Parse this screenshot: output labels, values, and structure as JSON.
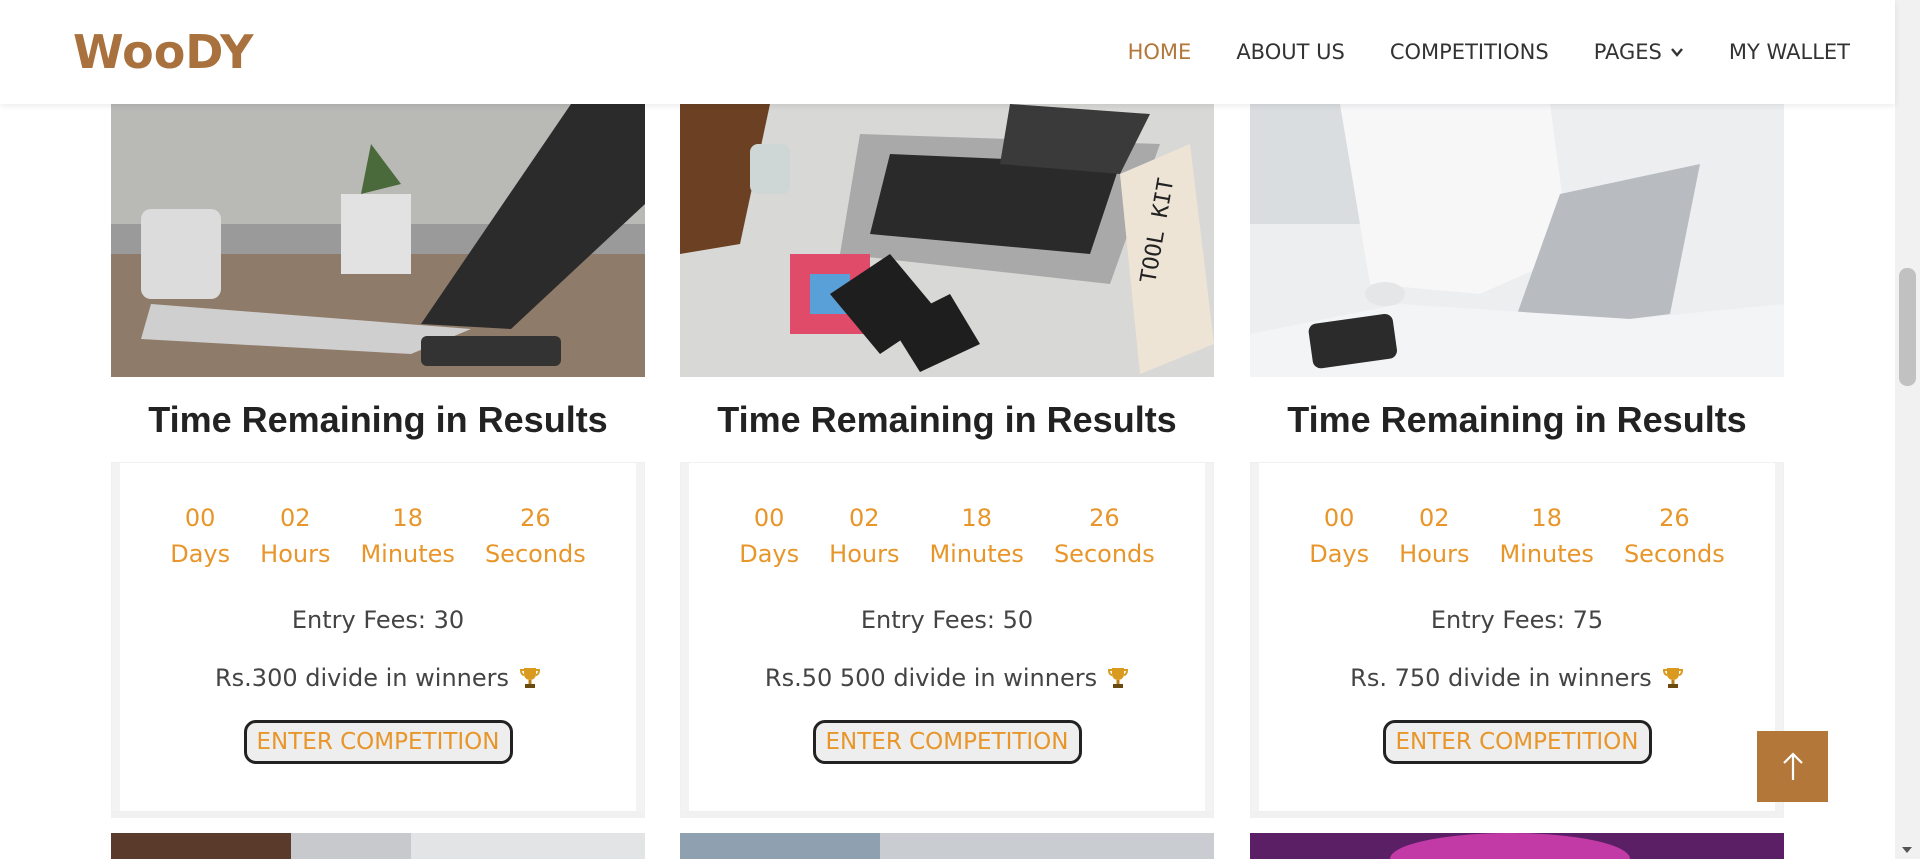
{
  "header": {
    "logo": "WooDY",
    "nav": [
      {
        "label": "HOME",
        "active": true
      },
      {
        "label": "ABOUT US",
        "active": false
      },
      {
        "label": "COMPETITIONS",
        "active": false
      },
      {
        "label": "PAGES",
        "active": false,
        "dropdown": true
      },
      {
        "label": "MY WALLET",
        "active": false
      }
    ]
  },
  "cards": [
    {
      "image_icon": "laptop-desk-photo",
      "title": "Time Remaining in Results",
      "timer": [
        {
          "value": "00",
          "unit": "Days"
        },
        {
          "value": "02",
          "unit": "Hours"
        },
        {
          "value": "18",
          "unit": "Minutes"
        },
        {
          "value": "26",
          "unit": "Seconds"
        }
      ],
      "entry": "Entry Fees: 30",
      "prize": "Rs.300 divide in winners",
      "button": "ENTER COMPETITION"
    },
    {
      "image_icon": "design-laptop-photo",
      "title": "Time Remaining in Results",
      "timer": [
        {
          "value": "00",
          "unit": "Days"
        },
        {
          "value": "02",
          "unit": "Hours"
        },
        {
          "value": "18",
          "unit": "Minutes"
        },
        {
          "value": "26",
          "unit": "Seconds"
        }
      ],
      "entry": "Entry Fees: 50",
      "prize": "Rs.50 500 divide in winners",
      "button": "ENTER COMPETITION"
    },
    {
      "image_icon": "woman-laptop-photo",
      "title": "Time Remaining in Results",
      "timer": [
        {
          "value": "00",
          "unit": "Days"
        },
        {
          "value": "02",
          "unit": "Hours"
        },
        {
          "value": "18",
          "unit": "Minutes"
        },
        {
          "value": "26",
          "unit": "Seconds"
        }
      ],
      "entry": "Entry Fees: 75",
      "prize": "Rs. 750 divide in winners",
      "button": "ENTER COMPETITION"
    }
  ],
  "colors": {
    "brand": "#a8713d",
    "accent": "#e8962a",
    "nav_active": "#b3773a",
    "to_top_bg": "#b3773a"
  }
}
